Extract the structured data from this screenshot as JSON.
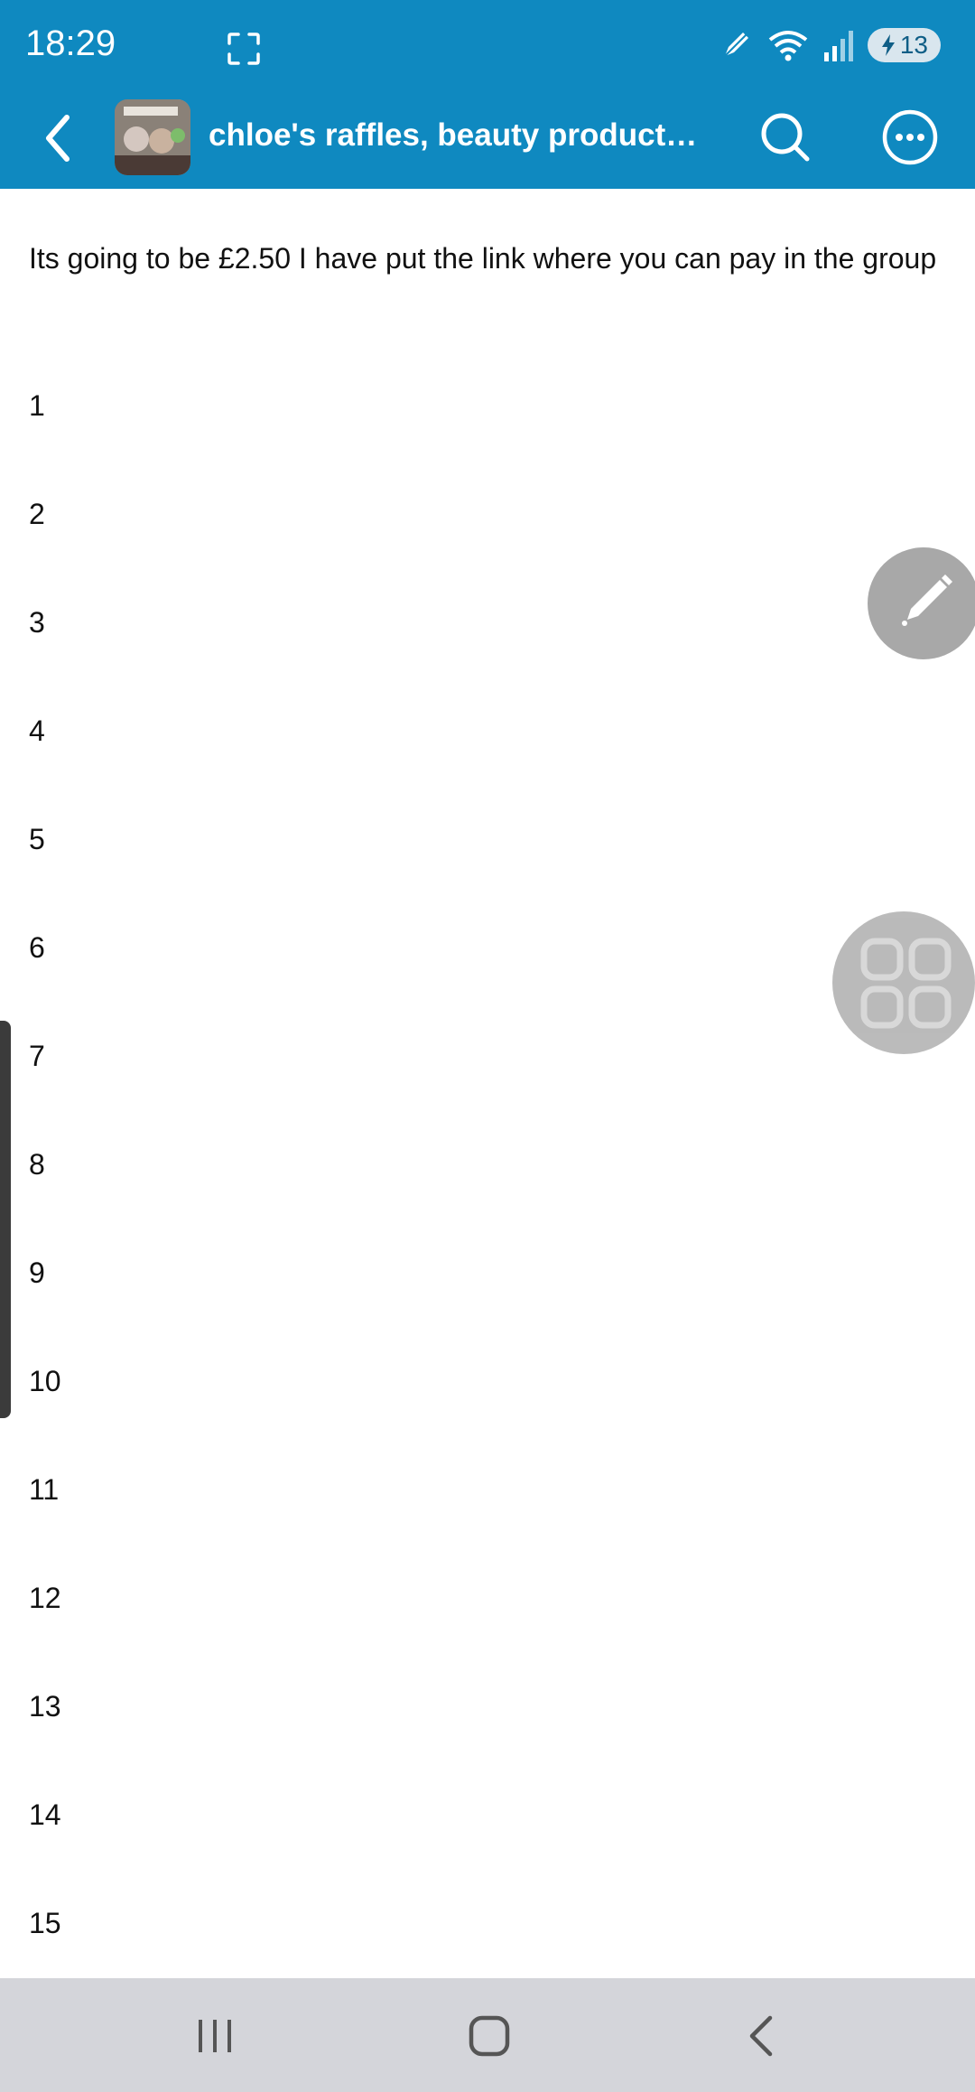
{
  "colors": {
    "accent": "#0f89c0",
    "navbar": "#d4d5da"
  },
  "status_bar": {
    "time": "18:29",
    "battery": "13",
    "icons": [
      "screenshot-icon",
      "pen-icon",
      "wifi-icon",
      "signal-icon",
      "battery-icon"
    ]
  },
  "app_bar": {
    "title": "chloe's raffles, beauty products ki...",
    "icons": [
      "back-arrow-icon",
      "group-avatar",
      "search-icon",
      "more-options-icon"
    ]
  },
  "post": {
    "intro": "Its going to be £2.50 I have put the link where you can pay in the group",
    "numbers": [
      "1",
      "2",
      "3",
      "4",
      "5",
      "6",
      "7",
      "8",
      "9",
      "10",
      "11",
      "12",
      "13",
      "14",
      "15"
    ]
  },
  "floating": {
    "icons": [
      "pencil-icon",
      "apps-grid-icon"
    ]
  },
  "nav_bar": {
    "icons": [
      "recents-icon",
      "home-icon",
      "back-icon"
    ]
  }
}
